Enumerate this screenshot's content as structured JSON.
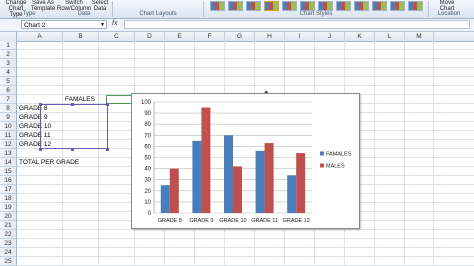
{
  "ribbon": {
    "buttons": [
      "Change Chart Type",
      "Save As Template",
      "Switch Row/Column",
      "Select Data",
      "Move Chart"
    ],
    "groups": [
      "Type",
      "Data",
      "Chart Layouts",
      "Chart Styles",
      "Location"
    ]
  },
  "formula_bar": {
    "name_box": "Chart 2",
    "fx": "fx",
    "formula": ""
  },
  "columns": [
    "A",
    "B",
    "C",
    "D",
    "E",
    "F",
    "G",
    "H",
    "I",
    "J",
    "K",
    "L",
    "M"
  ],
  "rows": [
    "1",
    "2",
    "3",
    "4",
    "5",
    "6",
    "7",
    "8",
    "9",
    "10",
    "11",
    "12",
    "13",
    "14",
    "15",
    "16",
    "17",
    "18",
    "19",
    "20",
    "21",
    "22",
    "23",
    "24",
    "25"
  ],
  "cells": {
    "c7": "FAMALES",
    "b8": "GRADE 8",
    "b9": "GRADE 9",
    "b10": "GRADE 10",
    "b11": "GRADE 11",
    "b12": "GRADE 12",
    "b14": "TOTAL PER GRADE"
  },
  "colors": {
    "females": "#4a7ebb",
    "males": "#c0504d",
    "ribbon": "#dbe5f1"
  },
  "chart_data": {
    "type": "bar",
    "categories": [
      "GRADE 8",
      "GRADE 9",
      "GRADE 10",
      "GRADE 11",
      "GRADE 12"
    ],
    "series": [
      {
        "name": "FAMALES",
        "values": [
          25,
          65,
          70,
          56,
          34
        ]
      },
      {
        "name": "MALES",
        "values": [
          40,
          95,
          42,
          63,
          54
        ]
      }
    ],
    "ylim": [
      0,
      100
    ],
    "yticks": [
      0,
      10,
      20,
      30,
      40,
      50,
      60,
      70,
      80,
      90,
      100
    ],
    "grid": true,
    "legend": "right"
  }
}
